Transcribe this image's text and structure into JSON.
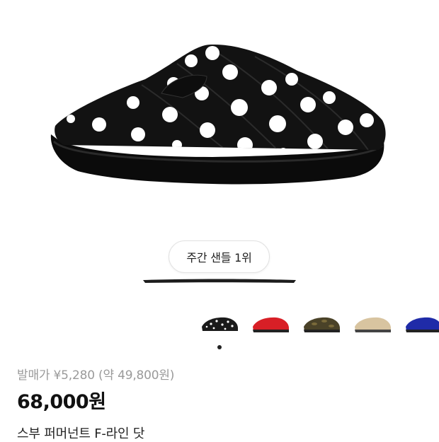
{
  "product": {
    "image_icon": "polka-dot-slipper-image",
    "rank_badge": "주간 샌들 1위",
    "release_price_label": "발매가 ¥5,280 (약 49,800원)",
    "price": "68,000원",
    "name": "스부 퍼머넌트 F-라인 닷"
  },
  "color_options": [
    {
      "icon": "black-polka-slipper-thumb",
      "color": "#1a1a1a",
      "pattern": "dots"
    },
    {
      "icon": "red-slipper-thumb",
      "color": "#d81f26",
      "pattern": "solid"
    },
    {
      "icon": "camo-slipper-thumb",
      "color": "#5a5030",
      "pattern": "camo"
    },
    {
      "icon": "beige-slipper-thumb",
      "color": "#d8c4a0",
      "pattern": "solid"
    },
    {
      "icon": "blue-slipper-thumb",
      "color": "#1f2ba8",
      "pattern": "solid"
    }
  ],
  "carousel": {
    "current_page": 1
  }
}
